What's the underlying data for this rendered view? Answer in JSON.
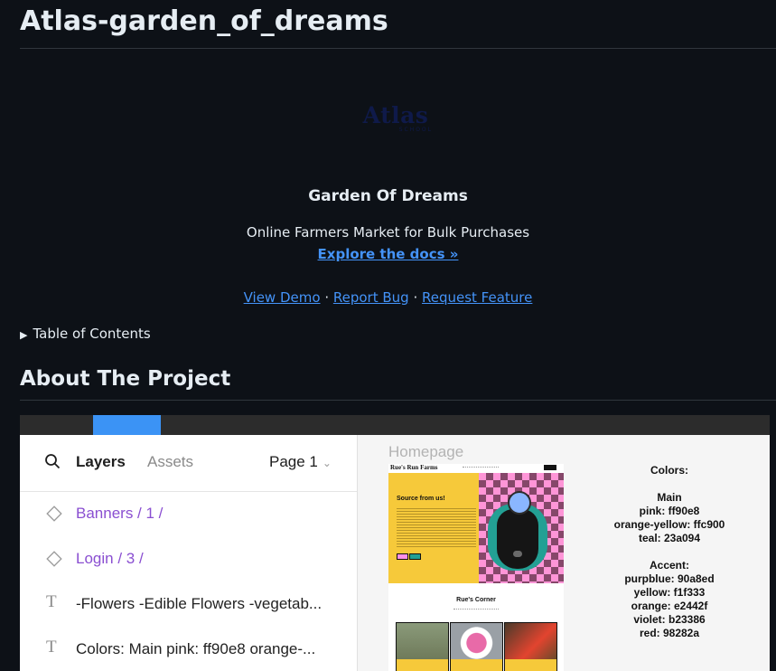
{
  "repo": {
    "title": "Atlas-garden_of_dreams"
  },
  "logo": {
    "main": "Atlas",
    "sub": "SCHOOL"
  },
  "project": {
    "name": "Garden Of Dreams",
    "tagline": "Online Farmers Market for Bulk Purchases",
    "docs_link": "Explore the docs »"
  },
  "links": {
    "demo": "View Demo",
    "bug": "Report Bug",
    "feature": "Request Feature",
    "separator": " · "
  },
  "toc": {
    "label": "Table of Contents"
  },
  "about": {
    "heading": "About The Project"
  },
  "figma": {
    "tabs": {
      "layers": "Layers",
      "assets": "Assets"
    },
    "page_selector": "Page 1",
    "layers": [
      {
        "type": "component",
        "label": "Banners / 1 /"
      },
      {
        "type": "component",
        "label": "Login / 3 /"
      },
      {
        "type": "text",
        "label": "-Flowers -Edible Flowers -vegetab..."
      },
      {
        "type": "text",
        "label": "Colors: Main pink: ff90e8 orange-..."
      }
    ],
    "frame_label": "Homepage",
    "frame": {
      "brand": "Rue's Run Farms",
      "hero_title": "Source from us!",
      "section_title": "Rue's Corner"
    },
    "notes": {
      "colors_heading": "Colors:",
      "main_heading": "Main",
      "main": [
        "pink: ff90e8",
        "orange-yellow: ffc900",
        "teal: 23a094"
      ],
      "accent_heading": "Accent:",
      "accent": [
        "purpblue: 90a8ed",
        "yellow: f1f333",
        "orange: e2442f",
        "violet: b23386",
        "red: 98282a"
      ]
    }
  },
  "colors": {
    "page_bg": "#0d1117",
    "link": "#4493f8",
    "figma_active_tab": "#3b93f5",
    "component_text": "#8a4fd1"
  }
}
